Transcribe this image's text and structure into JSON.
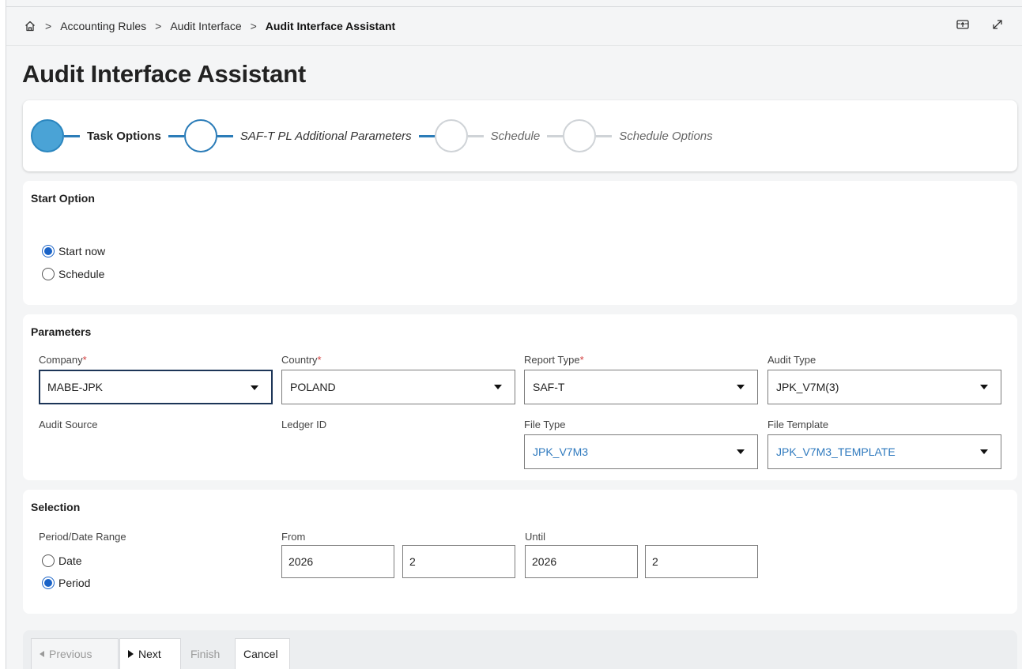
{
  "breadcrumb": {
    "items": [
      "Accounting Rules",
      "Audit Interface",
      "Audit Interface Assistant"
    ],
    "icons": {
      "home": "home-icon",
      "window": "window-icon",
      "expand": "expand-icon"
    }
  },
  "page": {
    "title": "Audit Interface Assistant"
  },
  "stepper": {
    "steps": [
      {
        "label": "Task Options",
        "state": "done"
      },
      {
        "label": "SAF-T PL Additional Parameters",
        "state": "active"
      },
      {
        "label": "Schedule",
        "state": "pending"
      },
      {
        "label": "Schedule Options",
        "state": "pending"
      }
    ],
    "colors": {
      "done": "#4aa3d6",
      "active_border": "#2b7cb8",
      "pending_border": "#cfd3d7"
    }
  },
  "start_option": {
    "title": "Start Option",
    "options": [
      "Start now",
      "Schedule"
    ],
    "selected": "Start now"
  },
  "parameters": {
    "title": "Parameters",
    "company": {
      "label": "Company",
      "value": "MABE-JPK",
      "required": true
    },
    "country": {
      "label": "Country",
      "value": "POLAND",
      "required": true
    },
    "report_type": {
      "label": "Report Type",
      "value": "SAF-T",
      "required": true
    },
    "audit_type": {
      "label": "Audit Type",
      "value": "JPK_V7M(3)"
    },
    "audit_source": {
      "label": "Audit Source"
    },
    "ledger_id": {
      "label": "Ledger ID"
    },
    "file_type": {
      "label": "File Type",
      "value": "JPK_V7M3"
    },
    "file_template": {
      "label": "File Template",
      "value": "JPK_V7M3_TEMPLATE"
    },
    "required_marker": "*"
  },
  "selection": {
    "title": "Selection",
    "range_label": "Period/Date Range",
    "range_options": [
      "Date",
      "Period"
    ],
    "range_selected": "Period",
    "from_label": "From",
    "from_year": "2026",
    "from_period": "2",
    "until_label": "Until",
    "until_year": "2026",
    "until_period": "2"
  },
  "footer": {
    "previous": "Previous",
    "next": "Next",
    "finish": "Finish",
    "cancel": "Cancel"
  },
  "colors": {
    "accent": "#1a63c7",
    "link": "#2e79be",
    "required": "#d23c3c"
  }
}
